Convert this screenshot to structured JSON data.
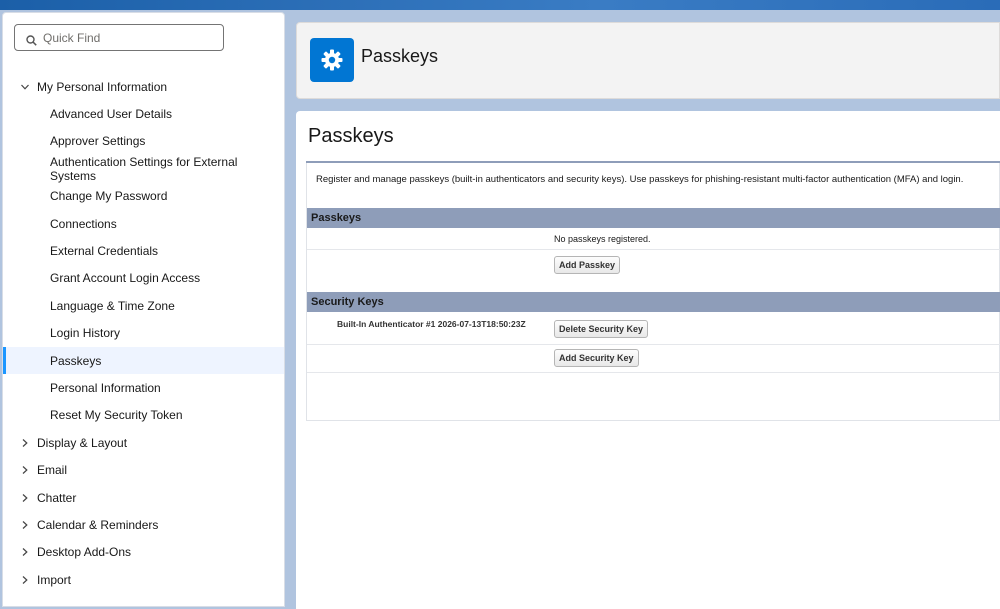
{
  "search": {
    "placeholder": "Quick Find"
  },
  "sidebar": {
    "items": [
      {
        "label": "My Personal Information",
        "type": "parent",
        "expanded": true
      },
      {
        "label": "Advanced User Details",
        "type": "child"
      },
      {
        "label": "Approver Settings",
        "type": "child"
      },
      {
        "label": "Authentication Settings for External Systems",
        "type": "child"
      },
      {
        "label": "Change My Password",
        "type": "child"
      },
      {
        "label": "Connections",
        "type": "child"
      },
      {
        "label": "External Credentials",
        "type": "child"
      },
      {
        "label": "Grant Account Login Access",
        "type": "child"
      },
      {
        "label": "Language & Time Zone",
        "type": "child"
      },
      {
        "label": "Login History",
        "type": "child"
      },
      {
        "label": "Passkeys",
        "type": "child",
        "selected": true
      },
      {
        "label": "Personal Information",
        "type": "child"
      },
      {
        "label": "Reset My Security Token",
        "type": "child"
      },
      {
        "label": "Display & Layout",
        "type": "parent",
        "expanded": false
      },
      {
        "label": "Email",
        "type": "parent",
        "expanded": false
      },
      {
        "label": "Chatter",
        "type": "parent",
        "expanded": false
      },
      {
        "label": "Calendar & Reminders",
        "type": "parent",
        "expanded": false
      },
      {
        "label": "Desktop Add-Ons",
        "type": "parent",
        "expanded": false
      },
      {
        "label": "Import",
        "type": "parent",
        "expanded": false
      }
    ]
  },
  "header": {
    "title": "Passkeys",
    "icon": "gear-icon"
  },
  "main": {
    "title": "Passkeys",
    "description": "Register and manage passkeys (built-in authenticators and security keys). Use passkeys for phishing-resistant multi-factor authentication (MFA) and login.",
    "passkeys_section": {
      "heading": "Passkeys",
      "empty_text": "No passkeys registered.",
      "add_button": "Add Passkey"
    },
    "security_keys_section": {
      "heading": "Security Keys",
      "key_name": "Built-In Authenticator #1 2026-07-13T18:50:23Z",
      "delete_button": "Delete Security Key",
      "add_button": "Add Security Key"
    }
  },
  "colors": {
    "accent": "#0176d3",
    "section_header": "#8e9db9",
    "selected_bg": "#eef4ff",
    "selected_bar": "#1b96ff",
    "background": "#b0c4df"
  }
}
